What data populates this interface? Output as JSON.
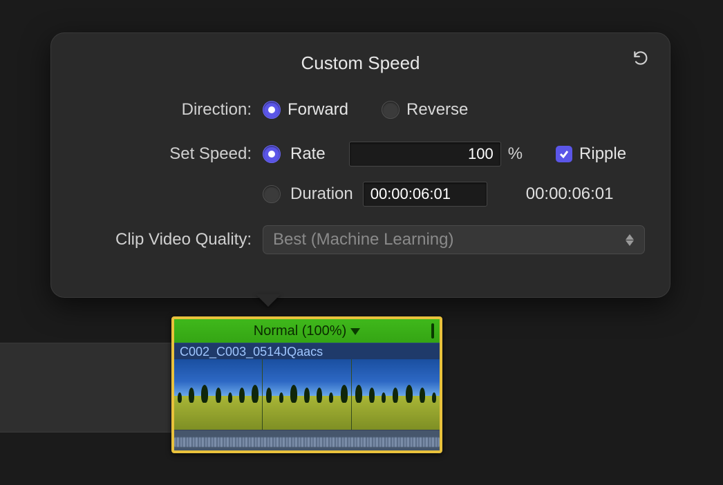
{
  "popover": {
    "title": "Custom Speed",
    "direction": {
      "label": "Direction:",
      "forward": "Forward",
      "reverse": "Reverse",
      "selected": "forward"
    },
    "setSpeed": {
      "label": "Set Speed:",
      "rateLabel": "Rate",
      "rateValue": "100",
      "rateUnit": "%",
      "durationLabel": "Duration",
      "durationValue": "00:00:06:01",
      "durationDisplay": "00:00:06:01",
      "rippleLabel": "Ripple",
      "selected": "rate",
      "rippleChecked": true
    },
    "quality": {
      "label": "Clip Video Quality:",
      "selected": "Best (Machine Learning)"
    }
  },
  "clip": {
    "speedLabel": "Normal (100%)",
    "name": "C002_C003_0514JQaacs"
  }
}
